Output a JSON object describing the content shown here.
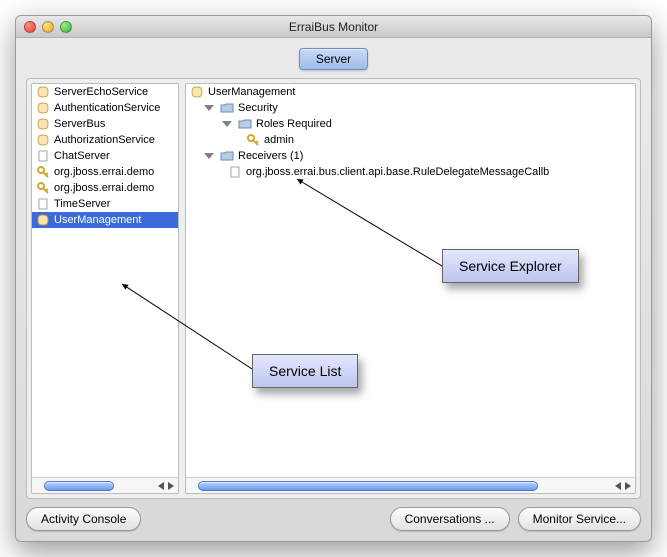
{
  "window": {
    "title": "ErraiBus Monitor"
  },
  "tabs": {
    "server": "Server"
  },
  "serviceList": {
    "items": [
      {
        "label": "ServerEchoService",
        "icon": "bean"
      },
      {
        "label": "AuthenticationService",
        "icon": "bean"
      },
      {
        "label": "ServerBus",
        "icon": "bean"
      },
      {
        "label": "AuthorizationService",
        "icon": "bean"
      },
      {
        "label": "ChatServer",
        "icon": "blank"
      },
      {
        "label": "org.jboss.errai.demo",
        "icon": "key"
      },
      {
        "label": "org.jboss.errai.demo",
        "icon": "key"
      },
      {
        "label": "TimeServer",
        "icon": "blank"
      },
      {
        "label": "UserManagement",
        "icon": "bean",
        "selected": true
      }
    ]
  },
  "tree": {
    "root": {
      "label": "UserManagement",
      "icon": "bean"
    },
    "security": {
      "label": "Security"
    },
    "rolesRequired": {
      "label": "Roles Required"
    },
    "admin": {
      "label": "admin"
    },
    "receivers": {
      "label": "Receivers (1)"
    },
    "receiverItem": {
      "label": "org.jboss.errai.bus.client.api.base.RuleDelegateMessageCallb"
    }
  },
  "buttons": {
    "activityConsole": "Activity Console",
    "conversations": "Conversations ...",
    "monitorService": "Monitor Service..."
  },
  "annotations": {
    "serviceExplorer": "Service Explorer",
    "serviceList": "Service List"
  }
}
